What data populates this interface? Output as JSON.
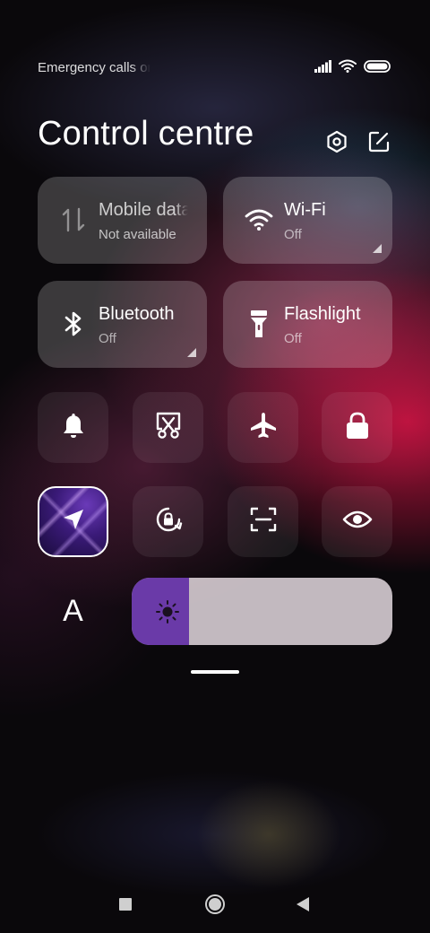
{
  "status_bar": {
    "carrier_text": "Emergency calls only",
    "icons": [
      "signal-icon",
      "wifi-icon",
      "battery-icon"
    ]
  },
  "header": {
    "title": "Control centre",
    "icons": [
      "settings-icon",
      "edit-icon"
    ]
  },
  "tiles": [
    {
      "label": "Mobile data",
      "status": "Not available",
      "icon": "mobile-data-icon"
    },
    {
      "label": "Wi-Fi",
      "status": "Off",
      "icon": "wifi-icon"
    },
    {
      "label": "Bluetooth",
      "status": "Off",
      "icon": "bluetooth-icon"
    },
    {
      "label": "Flashlight",
      "status": "Off",
      "icon": "flashlight-icon"
    }
  ],
  "toggles_row1": [
    "bell-icon",
    "screenshot-icon",
    "airplane-icon",
    "lock-icon"
  ],
  "toggles_row2": [
    "location-icon",
    "auto-rotate-icon",
    "scanner-icon",
    "eye-icon"
  ],
  "active_toggle": "location-icon",
  "font_size_label": "A",
  "brightness": {
    "level": 0.22,
    "icon": "sun-icon"
  },
  "nav_bar": [
    "recents-icon",
    "home-icon",
    "back-icon"
  ],
  "colors": {
    "accent": "#6a3aa8",
    "tile_bg": "rgba(255,255,255,0.2)",
    "brightness_track": "#e5dde2"
  }
}
